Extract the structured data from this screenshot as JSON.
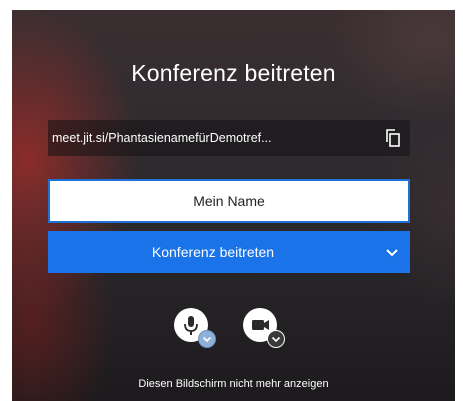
{
  "prejoin": {
    "title": "Konferenz beitreten",
    "meeting_url": "meet.jit.si/PhantasienamefürDemotref...",
    "name_input": {
      "value": "Mein Name",
      "placeholder": "Mein Name"
    },
    "join_button_label": "Konferenz beitreten",
    "hide_screen_label": "Diesen Bildschirm nicht mehr anzeigen"
  },
  "icons": {
    "copy": "copy-icon",
    "chevron": "chevron-down-icon",
    "microphone": "microphone-icon",
    "camera": "video-camera-icon",
    "settings_arrow": "chevron-down-icon"
  },
  "colors": {
    "accent": "#1a73e8",
    "input_border": "#1f6fd6",
    "text_light": "#ffffff"
  }
}
